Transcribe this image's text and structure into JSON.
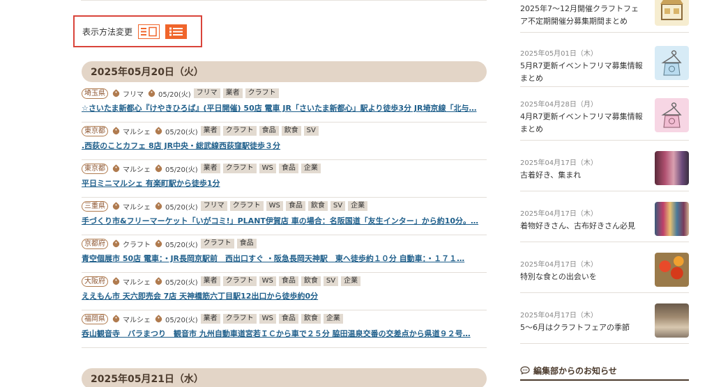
{
  "view_toggle": {
    "label": "表示方法変更"
  },
  "date_headers": [
    "2025年05月20日（火）",
    "2025年05月21日（水）"
  ],
  "events": [
    {
      "pref": "埼玉県",
      "category": "フリマ",
      "date": "05/20(火)",
      "chips": [
        "フリマ",
        "業者",
        "クラフト"
      ],
      "title": "☆さいたま新都心『けやきひろば』(平日開催) 50店 電車 JR「さいたま新都心」駅より徒歩3分 JR埼京線「北与…"
    },
    {
      "pref": "東京都",
      "category": "マルシェ",
      "date": "05/20(火)",
      "chips": [
        "業者",
        "クラフト",
        "食品",
        "飲食",
        "SV"
      ],
      "title": ".西荻のことカフェ 8店 JR中央・総武線西荻窪駅徒歩３分"
    },
    {
      "pref": "東京都",
      "category": "マルシェ",
      "date": "05/20(火)",
      "chips": [
        "業者",
        "クラフト",
        "WS",
        "食品",
        "企業"
      ],
      "title": "平日ミニマルシェ 有楽町駅から徒歩1分"
    },
    {
      "pref": "三重県",
      "category": "マルシェ",
      "date": "05/20(火)",
      "chips": [
        "フリマ",
        "クラフト",
        "WS",
        "食品",
        "飲食",
        "SV",
        "企業"
      ],
      "title": "手づくり市&フリーマーケット「いがコミ!」PLANT伊賀店 車の場合：名阪国道「友生インター」から約10分。…"
    },
    {
      "pref": "京都府",
      "category": "クラフト",
      "date": "05/20(火)",
      "chips": [
        "クラフト",
        "食品"
      ],
      "title": "青空個展市 50店 電車：・JR長岡京駅前　西出口すぐ ・阪急長岡天神駅　東へ徒歩約１０分 自動車：・１７１…"
    },
    {
      "pref": "大阪府",
      "category": "マルシェ",
      "date": "05/20(火)",
      "chips": [
        "業者",
        "クラフト",
        "WS",
        "食品",
        "飲食",
        "SV",
        "企業"
      ],
      "title": "ええもん市 天六即売会 7店 天神橋筋六丁目駅12出口から徒歩約0分"
    },
    {
      "pref": "福岡県",
      "category": "マルシェ",
      "date": "05/20(火)",
      "chips": [
        "業者",
        "クラフト",
        "WS",
        "食品",
        "飲食",
        "企業"
      ],
      "title": "呑山観音寺　バラまつり　観音市 九州自動車道宮若ＩＣから車で２５分 脇田温泉交番の交差点から県道９２号…"
    }
  ],
  "sidebar": {
    "articles": [
      {
        "date": "",
        "title": "2025年7〜12月開催クラフトフェア不定期開催分募集期間まとめ",
        "thumb": "craft-fair-icon"
      },
      {
        "date": "2025年05月01日（木）",
        "title": "5月R7更新イベントフリマ募集情報まとめ",
        "thumb": "clothes-hanger-icon"
      },
      {
        "date": "2025年04月28日（月）",
        "title": "4月R7更新イベントフリマ募集情報まとめ",
        "thumb": "clothes-hanger-icon"
      },
      {
        "date": "2025年04月17日（木）",
        "title": "古着好き、集まれ",
        "thumb": "used-clothing-photo"
      },
      {
        "date": "2025年04月17日（木）",
        "title": "着物好きさん、古布好きさん必見",
        "thumb": "kimono-photo"
      },
      {
        "date": "2025年04月17日（木）",
        "title": "特別な食との出会いを",
        "thumb": "food-photo"
      },
      {
        "date": "2025年04月17日（木）",
        "title": "5〜6月はクラフトフェアの季節",
        "thumb": "craft-photo"
      }
    ],
    "notice_heading": "編集部からのお知らせ"
  },
  "colors": {
    "accent": "#f0652b",
    "highlight_border": "#d9443a",
    "date_bar": "#e3d5c7",
    "link": "#1f5f8b",
    "pref_border": "#b07b4f"
  }
}
